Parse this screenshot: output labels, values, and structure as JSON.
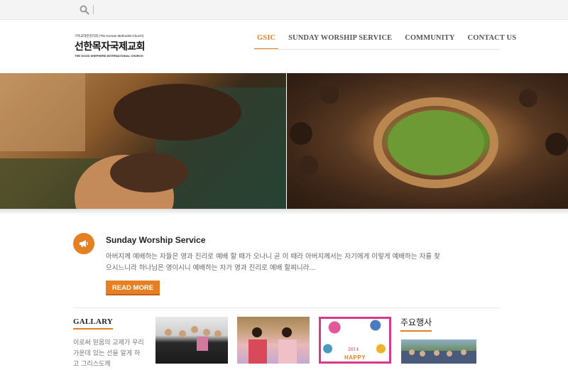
{
  "topbar": {
    "search_icon": "search-icon"
  },
  "logo": {
    "line1": "기독교대한감리회 (The Korean Methodist Church)",
    "name": "선한목자국제교회",
    "line3": "THE GOOD SHEPHERD INTERNATIONAL CHURCH"
  },
  "nav": {
    "items": [
      "GSIC",
      "SUNDAY WORSHIP SERVICE",
      "COMMUNITY",
      "CONTACT US"
    ],
    "active": "GSIC",
    "accent": "#e67e22"
  },
  "feature": {
    "icon": "megaphone-icon",
    "title": "Sunday Worship Service",
    "body": "아버지께 예배하는 자들은 영과 진리로 예배 할 때가 오나니 곧 이 때라 아버지께서는 자기에게 이렇게 예배하는 자를 찾으시느니라 하나님은 영이시니 예배하는 자가 영과 진리로 예배 할찌니라...",
    "button": "READ MORE"
  },
  "gallery": {
    "title": "GALLARY",
    "text": "이로써 믿음의 교제가 우리 가운데 있는 선을 알게 하고 그리스도께"
  },
  "card": {
    "year": "2014",
    "happy": "HAPPY"
  },
  "events": {
    "title": "주요행사"
  }
}
